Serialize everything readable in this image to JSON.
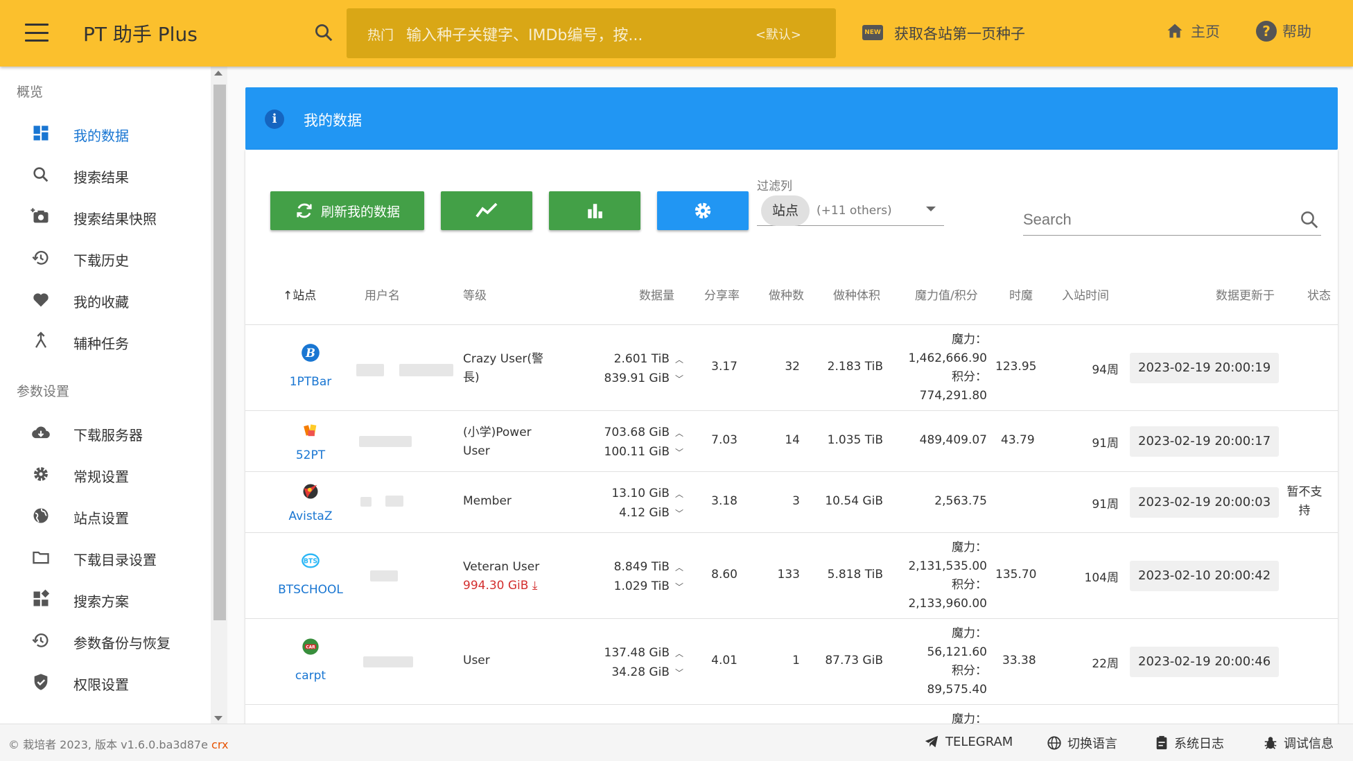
{
  "header": {
    "title": "PT 助手 Plus",
    "search_hot": "热门",
    "search_placeholder": "输入种子关键字、IMDb编号，按...",
    "search_default": "<默认>",
    "new_badge": "NEW",
    "newtorrent": "获取各站第一页种子",
    "home": "主页",
    "help": "帮助"
  },
  "sidebar": {
    "section_overview": "概览",
    "section_settings": "参数设置",
    "items": [
      {
        "label": "我的数据",
        "icon": "dashboard-icon",
        "active": true
      },
      {
        "label": "搜索结果",
        "icon": "search-icon"
      },
      {
        "label": "搜索结果快照",
        "icon": "camera-add-icon"
      },
      {
        "label": "下载历史",
        "icon": "history-icon"
      },
      {
        "label": "我的收藏",
        "icon": "heart-icon"
      },
      {
        "label": "辅种任务",
        "icon": "merge-icon"
      },
      {
        "label": "下载服务器",
        "icon": "cloud-download-icon"
      },
      {
        "label": "常规设置",
        "icon": "gear-icon"
      },
      {
        "label": "站点设置",
        "icon": "globe-icon"
      },
      {
        "label": "下载目录设置",
        "icon": "folder-icon"
      },
      {
        "label": "搜索方案",
        "icon": "widgets-icon"
      },
      {
        "label": "参数备份与恢复",
        "icon": "restore-icon"
      },
      {
        "label": "权限设置",
        "icon": "shield-icon"
      }
    ]
  },
  "main": {
    "info_title": "我的数据",
    "refresh_label": "刷新我的数据",
    "filter_label": "过滤列",
    "filter_chip": "站点",
    "filter_others": "(+11 others)",
    "search_placeholder": "Search",
    "columns": [
      "站点",
      "用户名",
      "等级",
      "数据量",
      "分享率",
      "做种数",
      "做种体积",
      "魔力值/积分",
      "时魔",
      "入站时间",
      "数据更新于",
      "状态"
    ],
    "rows": [
      {
        "site": "1PTBar",
        "icon_color": "#1976d2",
        "level": [
          "Crazy User(警",
          "長)"
        ],
        "upload": "2.601 TiB",
        "download": "839.91 GiB",
        "ratio": "3.17",
        "seeding": "32",
        "seed_size": "2.183 TiB",
        "bonus": [
          "魔力：",
          "1,462,666.90",
          "积分：",
          "774,291.80"
        ],
        "hourly": "123.95",
        "join": "94周",
        "updated": "2023-02-19 20:00:19",
        "status": ""
      },
      {
        "site": "52PT",
        "icon_color": "#f57c00",
        "level": [
          "(小学)Power",
          "User"
        ],
        "upload": "703.68 GiB",
        "download": "100.11 GiB",
        "ratio": "7.03",
        "seeding": "14",
        "seed_size": "1.035 TiB",
        "bonus": [
          "489,409.07"
        ],
        "hourly": "43.79",
        "join": "91周",
        "updated": "2023-02-19 20:00:17",
        "status": ""
      },
      {
        "site": "AvistaZ",
        "icon_color": "#d32f2f",
        "level": [
          "Member"
        ],
        "upload": "13.10 GiB",
        "download": "4.12 GiB",
        "ratio": "3.18",
        "seeding": "3",
        "seed_size": "10.54 GiB",
        "bonus": [
          "2,563.75"
        ],
        "hourly": "",
        "join": "91周",
        "updated": "2023-02-19 20:00:03",
        "status": "暂不支持"
      },
      {
        "site": "BTSCHOOL",
        "icon_color": "#29b6f6",
        "level": [
          "Veteran User"
        ],
        "level_warning": "994.30 GiB",
        "upload": "8.849 TiB",
        "download": "1.029 TiB",
        "ratio": "8.60",
        "seeding": "133",
        "seed_size": "5.818 TiB",
        "bonus": [
          "魔力：",
          "2,131,535.00",
          "积分：",
          "2,133,960.00"
        ],
        "hourly": "135.70",
        "join": "104周",
        "updated": "2023-02-10 20:00:42",
        "status": ""
      },
      {
        "site": "carpt",
        "icon_color": "#388e3c",
        "level": [
          "User"
        ],
        "upload": "137.48 GiB",
        "download": "34.28 GiB",
        "ratio": "4.01",
        "seeding": "1",
        "seed_size": "87.73 GiB",
        "bonus": [
          "魔力：",
          "56,121.60",
          "积分：",
          "89,575.40"
        ],
        "hourly": "33.38",
        "join": "22周",
        "updated": "2023-02-19 20:00:46",
        "status": ""
      }
    ],
    "partial_row_bonus": "魔力："
  },
  "footer": {
    "copyright": "© 栽培者 2023, 版本 v1.6.0.ba3d87e",
    "crx": "crx",
    "telegram": "TELEGRAM",
    "language": "切换语言",
    "logs": "系统日志",
    "debug": "调试信息"
  },
  "colors": {
    "topbar": "#fbc02d",
    "primary": "#2196f3",
    "success": "#43a047",
    "link": "#1976d2",
    "warning": "#d32f2f"
  }
}
